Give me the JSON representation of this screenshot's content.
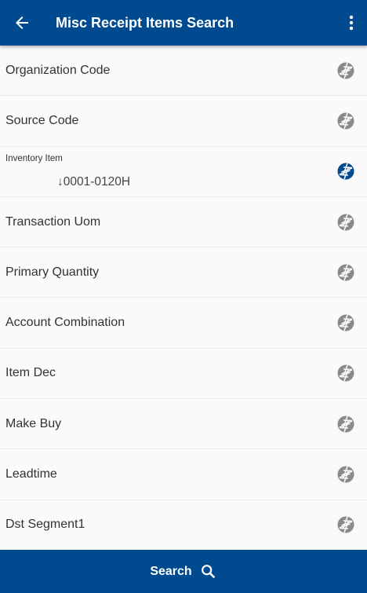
{
  "header": {
    "title": "Misc Receipt Items Search",
    "back_icon": "arrow-left-icon",
    "menu_icon": "more-vert-icon"
  },
  "fields": [
    {
      "label": "Organization Code",
      "active": false
    },
    {
      "label": "Source Code",
      "active": false
    },
    {
      "label": "Inventory Item",
      "value": "0001-0120H",
      "sort_icon": "arrow-down-icon",
      "active": true
    },
    {
      "label": "Transaction Uom",
      "active": false
    },
    {
      "label": "Primary Quantity",
      "active": false
    },
    {
      "label": "Account Combination",
      "active": false
    },
    {
      "label": "Item Dec",
      "active": false
    },
    {
      "label": "Make Buy",
      "active": false
    },
    {
      "label": "Leadtime",
      "active": false
    },
    {
      "label": "Dst Segment1",
      "active": false
    }
  ],
  "footer": {
    "search_label": "Search",
    "icon": "search-icon"
  },
  "colors": {
    "primary": "#004a8f",
    "icon_inactive": "#8a8a8a",
    "icon_active": "#004a8f"
  }
}
